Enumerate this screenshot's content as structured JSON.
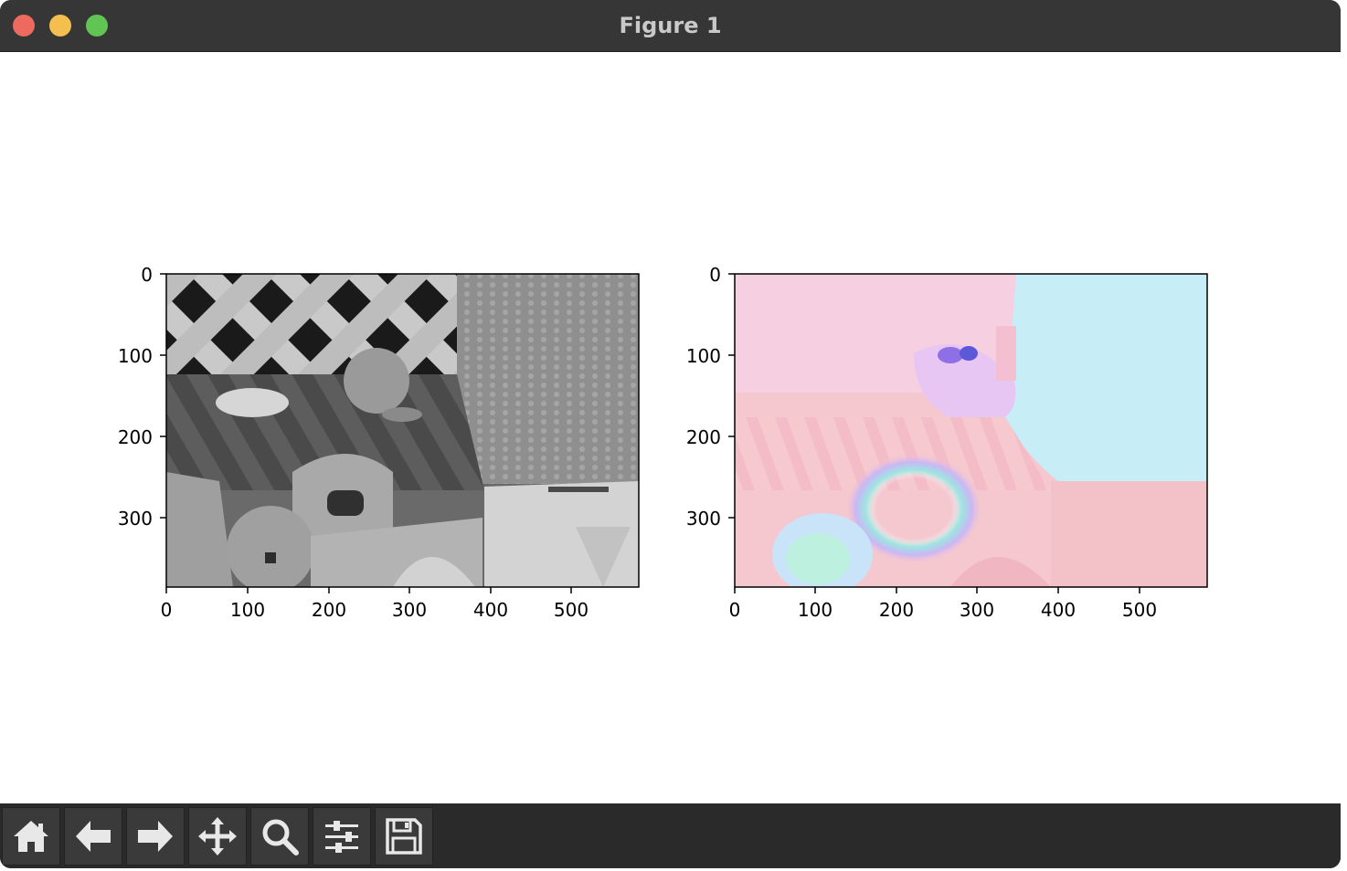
{
  "window": {
    "title": "Figure 1"
  },
  "toolbar": {
    "buttons": [
      {
        "name": "home",
        "icon": "home-icon"
      },
      {
        "name": "back",
        "icon": "arrow-left-icon"
      },
      {
        "name": "forward",
        "icon": "arrow-right-icon"
      },
      {
        "name": "pan",
        "icon": "move-icon"
      },
      {
        "name": "zoom",
        "icon": "magnifier-icon"
      },
      {
        "name": "configure-subplots",
        "icon": "sliders-icon"
      },
      {
        "name": "save",
        "icon": "floppy-disk-icon"
      }
    ]
  },
  "axes": {
    "left": {
      "xticks": [
        "0",
        "100",
        "200",
        "300",
        "400",
        "500"
      ],
      "yticks": [
        "0",
        "100",
        "200",
        "300"
      ],
      "image": "grayscale photograph"
    },
    "right": {
      "xticks": [
        "0",
        "100",
        "200",
        "300",
        "400",
        "500"
      ],
      "yticks": [
        "0",
        "100",
        "200",
        "300"
      ],
      "image": "optical flow color map"
    }
  },
  "colors": {
    "titlebar": "#363636",
    "toolbar": "#2a2a2a",
    "close": "#ed6a5e",
    "minimize": "#f5bf4f",
    "maximize": "#61c554"
  }
}
